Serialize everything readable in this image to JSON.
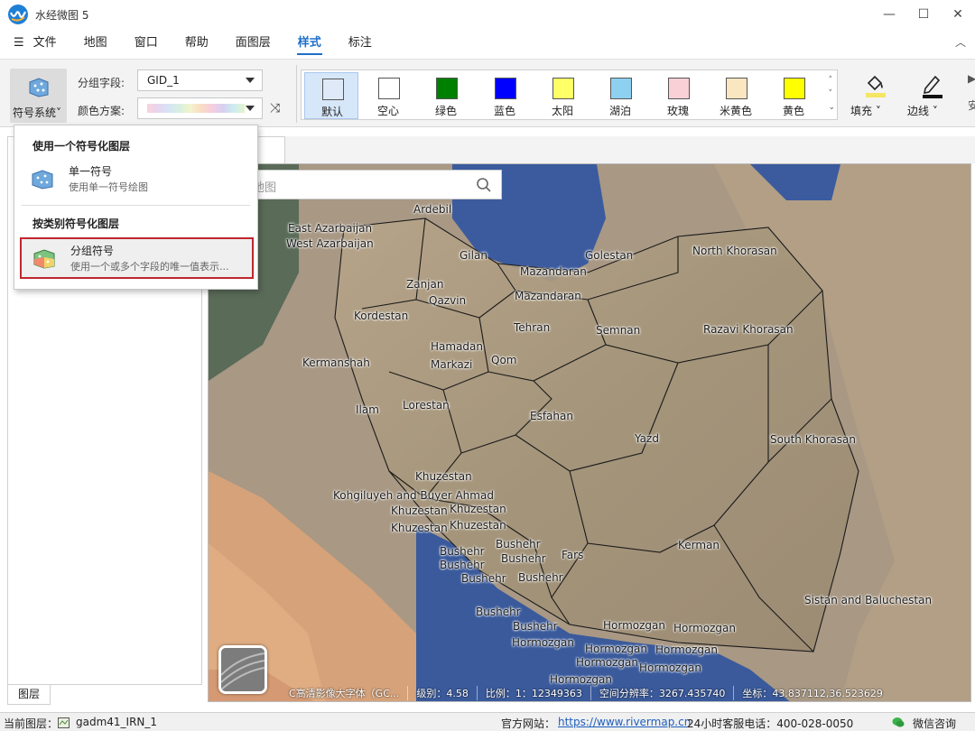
{
  "app": {
    "title": "水经微图 5",
    "icon": "app-logo-icon"
  },
  "window_controls": {
    "minimize": "—",
    "maximize": "☐",
    "close": "✕"
  },
  "menu": {
    "toggle_icon": "☰",
    "items": [
      {
        "label": "文件"
      },
      {
        "label": "地图"
      },
      {
        "label": "窗口"
      },
      {
        "label": "帮助"
      },
      {
        "label": "面图层"
      },
      {
        "label": "样式",
        "active": true
      },
      {
        "label": "标注"
      }
    ],
    "collapse_icon": "︿"
  },
  "ribbon": {
    "symbol_system": {
      "label": "符号系统",
      "caret": "˅"
    },
    "group_field": {
      "label": "分组字段:",
      "value": "GID_1"
    },
    "color_scheme": {
      "label": "颜色方案:"
    },
    "shuffle_icon": "⤨",
    "palette": [
      {
        "label": "默认",
        "color": "#dfe9f7",
        "selected": true
      },
      {
        "label": "空心",
        "color": "#ffffff"
      },
      {
        "label": "绿色",
        "color": "#008000"
      },
      {
        "label": "蓝色",
        "color": "#0000ff"
      },
      {
        "label": "太阳",
        "color": "#ffff66"
      },
      {
        "label": "湖泊",
        "color": "#8ed0f0"
      },
      {
        "label": "玫瑰",
        "color": "#f8d0d6"
      },
      {
        "label": "米黄色",
        "color": "#fbe6c2"
      },
      {
        "label": "黄色",
        "color": "#ffff00"
      }
    ],
    "palette_scroll": [
      "˄",
      "˅",
      "⌄"
    ],
    "fill": {
      "label": "填充",
      "caret": "˅"
    },
    "stroke": {
      "label": "边线",
      "caret": "˅"
    },
    "more": "▶",
    "edge_label": "安"
  },
  "dropdown": {
    "header1": "使用一个符号化图层",
    "item1": {
      "title": "单一符号",
      "desc": "使用单一符号绘图"
    },
    "header2": "按类别符号化图层",
    "item2": {
      "title": "分组符号",
      "desc": "使用一个或多个字段的唯一值表示..."
    }
  },
  "left_panel": {
    "tab_label": "图层"
  },
  "map": {
    "search_placeholder": "地图",
    "labels": [
      "Ardebil",
      "East Azarbaijan",
      "West Azarbaijan",
      "Gilan",
      "Golestan",
      "Mazandaran",
      "Mazandaran",
      "North Khorasan",
      "Zanjan",
      "Qazvin",
      "Kordestan",
      "Tehran",
      "Semnan",
      "Razavi Khorasan",
      "Hamadan",
      "Markazi",
      "Qom",
      "Kermanshah",
      "Ilam",
      "Lorestan",
      "Esfahan",
      "Yazd",
      "South Khorasan",
      "Khuzestan",
      "Kohgiluyeh and Buyer Ahmad",
      "Khuzestan",
      "Khuzestan",
      "Khuzestan",
      "Khuzestan",
      "Bushehr",
      "Bushehr",
      "Bushehr",
      "Bushehr",
      "Bushehr",
      "Bushehr",
      "Fars",
      "Kerman",
      "Bushehr",
      "Bushehr",
      "Hormozgan",
      "Hormozgan",
      "Hormozgan",
      "Hormozgan",
      "Hormozgan",
      "Hormozgan",
      "Hormozgan",
      "Hormozgan",
      "Sistan and Baluchestan"
    ],
    "status": {
      "basemap": "C高清影像大字体（GC...",
      "level": "级别：4.58",
      "scale": "比例：1：12349363",
      "area": "空间分辨率：3267.435740",
      "coords": "坐标：43.837112,36.523629"
    }
  },
  "statusbar": {
    "current_layer_label": "当前图层：",
    "current_layer": "gadm41_IRN_1",
    "website_label": "官方网站：",
    "website": "https://www.rivermap.cn",
    "hotline": "24小时客服电话：400-028-0050",
    "wechat": "微信咨询"
  }
}
